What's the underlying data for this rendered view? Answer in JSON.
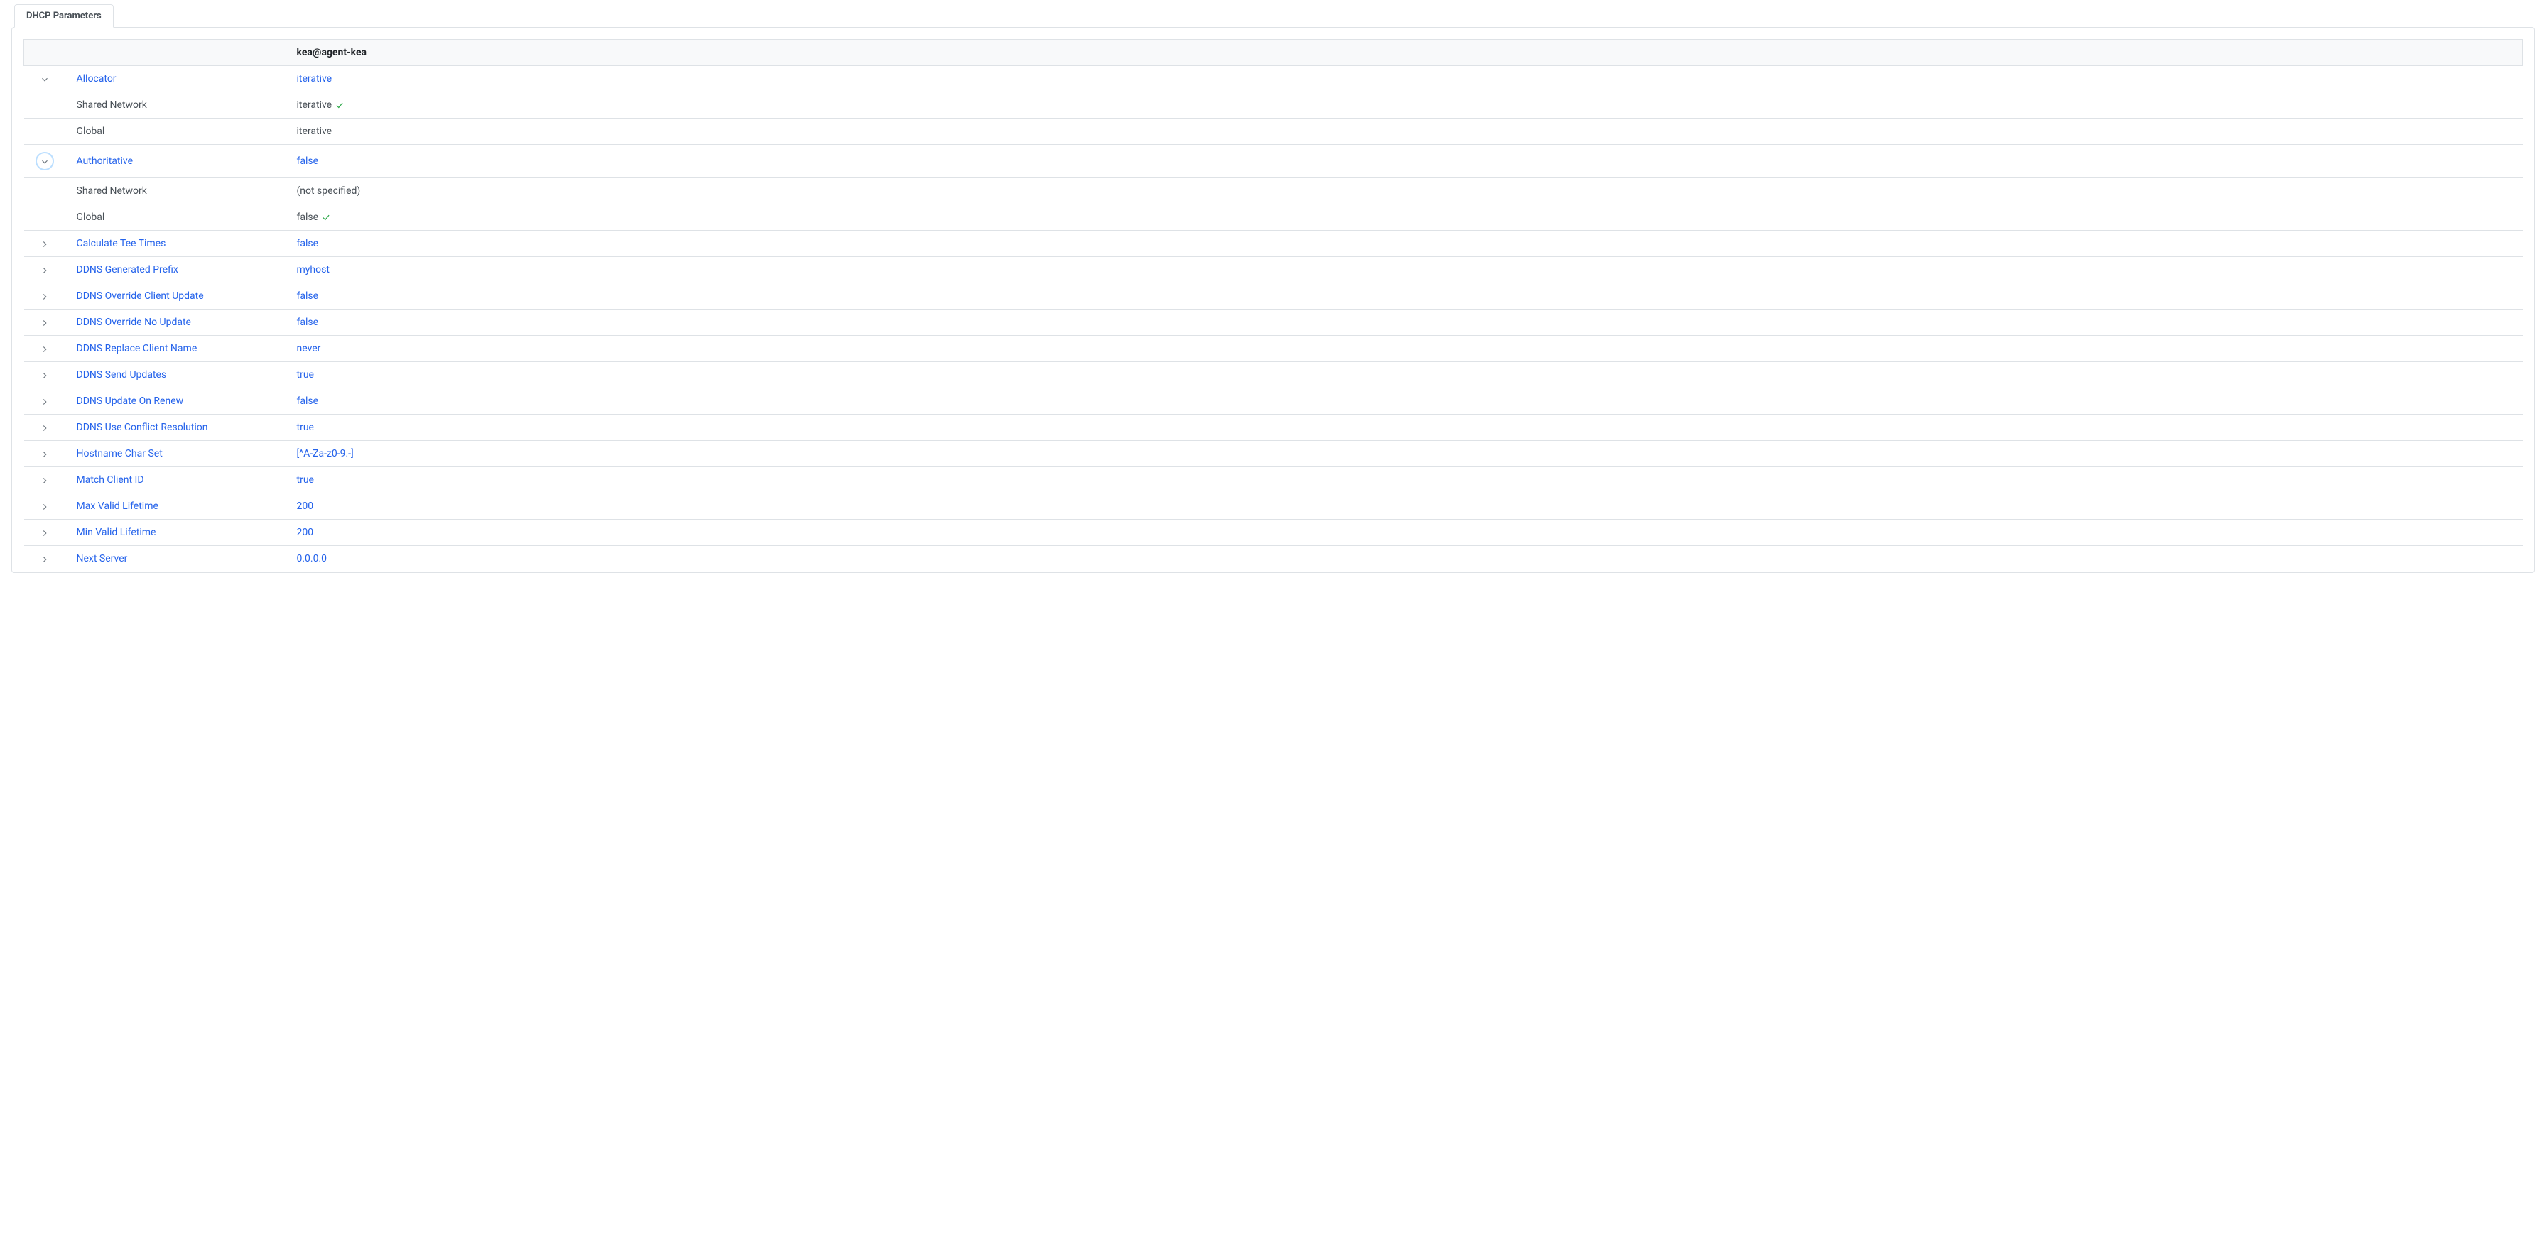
{
  "tabLabel": "DHCP Parameters",
  "headerValue": "kea@agent-kea",
  "rows": [
    {
      "expanded": true,
      "name": "Allocator",
      "value": "iterative",
      "children": [
        {
          "name": "Shared Network",
          "value": "iterative",
          "check": true
        },
        {
          "name": "Global",
          "value": "iterative",
          "check": false
        }
      ]
    },
    {
      "expanded": true,
      "focused": true,
      "name": "Authoritative",
      "value": "false",
      "children": [
        {
          "name": "Shared Network",
          "value": "(not specified)",
          "check": false
        },
        {
          "name": "Global",
          "value": "false",
          "check": true
        }
      ]
    },
    {
      "expanded": false,
      "name": "Calculate Tee Times",
      "value": "false"
    },
    {
      "expanded": false,
      "name": "DDNS Generated Prefix",
      "value": "myhost"
    },
    {
      "expanded": false,
      "name": "DDNS Override Client Update",
      "value": "false"
    },
    {
      "expanded": false,
      "name": "DDNS Override No Update",
      "value": "false"
    },
    {
      "expanded": false,
      "name": "DDNS Replace Client Name",
      "value": "never"
    },
    {
      "expanded": false,
      "name": "DDNS Send Updates",
      "value": "true"
    },
    {
      "expanded": false,
      "name": "DDNS Update On Renew",
      "value": "false"
    },
    {
      "expanded": false,
      "name": "DDNS Use Conflict Resolution",
      "value": "true"
    },
    {
      "expanded": false,
      "name": "Hostname Char Set",
      "value": "[^A-Za-z0-9.-]"
    },
    {
      "expanded": false,
      "name": "Match Client ID",
      "value": "true"
    },
    {
      "expanded": false,
      "name": "Max Valid Lifetime",
      "value": "200"
    },
    {
      "expanded": false,
      "name": "Min Valid Lifetime",
      "value": "200"
    },
    {
      "expanded": false,
      "name": "Next Server",
      "value": "0.0.0.0"
    }
  ]
}
